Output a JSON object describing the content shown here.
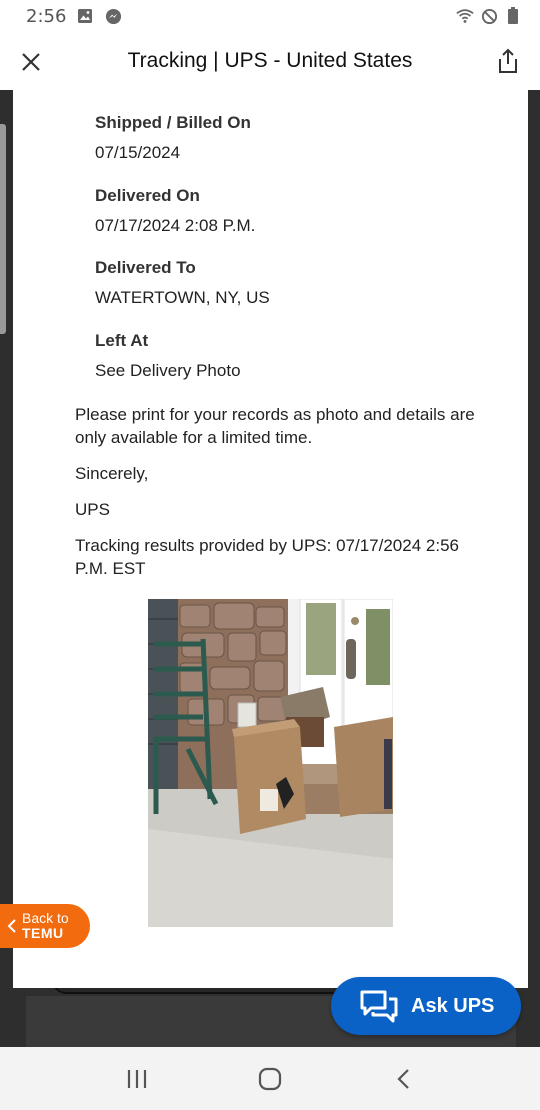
{
  "status_bar": {
    "time": "2:56",
    "left_icons": [
      "image-icon",
      "messenger-icon"
    ],
    "right_icons": [
      "wifi-icon",
      "do-not-disturb-icon",
      "battery-icon"
    ]
  },
  "app_bar": {
    "title": "Tracking | UPS - United States",
    "close_icon": "close-icon",
    "share_icon": "share-icon"
  },
  "details": [
    {
      "label": "Shipped / Billed On",
      "value": "07/15/2024"
    },
    {
      "label": "Delivered On",
      "value": "07/17/2024 2:08 P.M."
    },
    {
      "label": "Delivered To",
      "value": "WATERTOWN, NY, US"
    },
    {
      "label": "Left At",
      "value": "See Delivery Photo"
    }
  ],
  "message": {
    "notice": "Please print for your records as photo and details are only available for a limited time.",
    "closing": "Sincerely,",
    "signature": "UPS",
    "results": "Tracking results provided by UPS: 07/17/2024 2:56 P.M. EST"
  },
  "delivery_photo": {
    "description_icon": "delivery-photo"
  },
  "back_to_temu": {
    "line1": "Back to",
    "line2": "TEMU"
  },
  "ask_ups": {
    "label": "Ask UPS"
  },
  "nav_bar": {
    "icons": [
      "recent-apps-icon",
      "home-icon",
      "back-icon"
    ]
  },
  "colors": {
    "ups_blue": "#0a61c6",
    "temu_orange": "#f26b0f"
  }
}
